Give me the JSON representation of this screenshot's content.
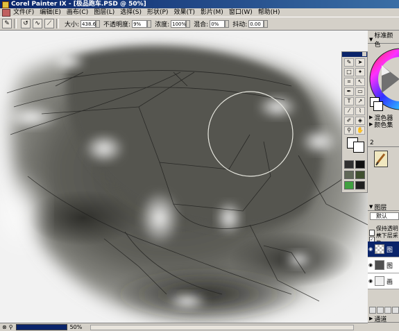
{
  "app": {
    "title": "Corel Painter IX - [极品跑车.PSD @ 50%]"
  },
  "menu": {
    "items": [
      "文件(F)",
      "编辑(E)",
      "画布(C)",
      "图层(L)",
      "选择(S)",
      "形状(P)",
      "效果(T)",
      "影片(M)",
      "窗口(W)",
      "帮助(H)"
    ]
  },
  "propbar": {
    "size_label": "大小:",
    "size_value": "438.6",
    "opacity_label": "不透明度:",
    "opacity_value": "9%",
    "grain_label": "浓度:",
    "grain_value": "100%",
    "resat_label": "混合:",
    "resat_value": "0%",
    "jitter_label": "抖动:",
    "jitter_value": "0.00"
  },
  "colors_panel": {
    "title": "标准颜色",
    "mixer_label": "混色器",
    "sets_label": "颜色集"
  },
  "brush_panel": {
    "number": "2"
  },
  "layers_panel": {
    "title": "图层",
    "blend_mode": "默认",
    "preserve_label": "保持透明度",
    "pick_up_label": "从下层采集",
    "layers": [
      {
        "name": "图"
      },
      {
        "name": "图"
      },
      {
        "name": "画"
      }
    ],
    "channels_label": "通道"
  },
  "status": {
    "zoom": "50%"
  },
  "icons": {
    "app": "painter-brush-icon",
    "brush_tool": "brush-icon"
  },
  "accent": {
    "titlebar": "#0a246a",
    "wheel_border": "#202020"
  }
}
